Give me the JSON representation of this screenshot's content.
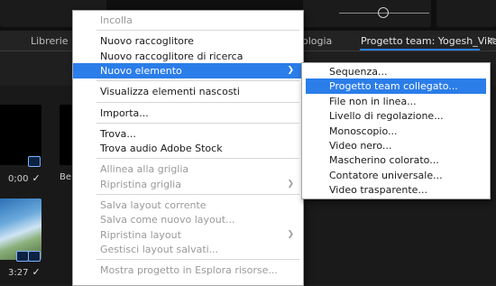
{
  "header": {
    "tabs": [
      {
        "label": "Librerie"
      },
      {
        "label": "ologia"
      },
      {
        "label": "Progetto team: Yogesh_Vikas"
      }
    ],
    "more_glyph": "≡"
  },
  "thumbnails": [
    {
      "duration": "0;00",
      "badge": true
    },
    {
      "duration": "3:27",
      "badge": true
    }
  ],
  "partial_label": "Be",
  "check_glyph": "✓",
  "context_menu": {
    "items": [
      {
        "label": "Incolla",
        "disabled": true
      },
      {
        "separator": true
      },
      {
        "label": "Nuovo raccoglitore"
      },
      {
        "label": "Nuovo raccoglitore di ricerca"
      },
      {
        "label": "Nuovo elemento",
        "submenu": true,
        "highlighted": true
      },
      {
        "separator": true
      },
      {
        "label": "Visualizza elementi nascosti"
      },
      {
        "separator": true
      },
      {
        "label": "Importa..."
      },
      {
        "separator": true
      },
      {
        "label": "Trova..."
      },
      {
        "label": "Trova audio Adobe Stock"
      },
      {
        "separator": true
      },
      {
        "label": "Allinea alla griglia",
        "disabled": true
      },
      {
        "label": "Ripristina griglia",
        "disabled": true,
        "submenu": true
      },
      {
        "separator": true
      },
      {
        "label": "Salva layout corrente",
        "disabled": true
      },
      {
        "label": "Salva come nuovo layout...",
        "disabled": true
      },
      {
        "label": "Ripristina layout",
        "disabled": true,
        "submenu": true
      },
      {
        "label": "Gestisci layout salvati...",
        "disabled": true
      },
      {
        "separator": true
      },
      {
        "label": "Mostra progetto in Esplora risorse...",
        "disabled": true
      }
    ]
  },
  "submenu": {
    "items": [
      {
        "label": "Sequenza..."
      },
      {
        "label": "Progetto team collegato...",
        "highlighted": true
      },
      {
        "label": "File non in linea..."
      },
      {
        "label": "Livello di regolazione..."
      },
      {
        "label": "Monoscopio..."
      },
      {
        "label": "Video nero..."
      },
      {
        "label": "Mascherino colorato..."
      },
      {
        "label": "Contatore universale..."
      },
      {
        "label": "Video trasparente..."
      }
    ]
  },
  "colors": {
    "highlight": "#2b7de9",
    "menu_bg": "#ffffff",
    "disabled_text": "#9a9a9a",
    "app_bg": "#1d1d1d"
  }
}
